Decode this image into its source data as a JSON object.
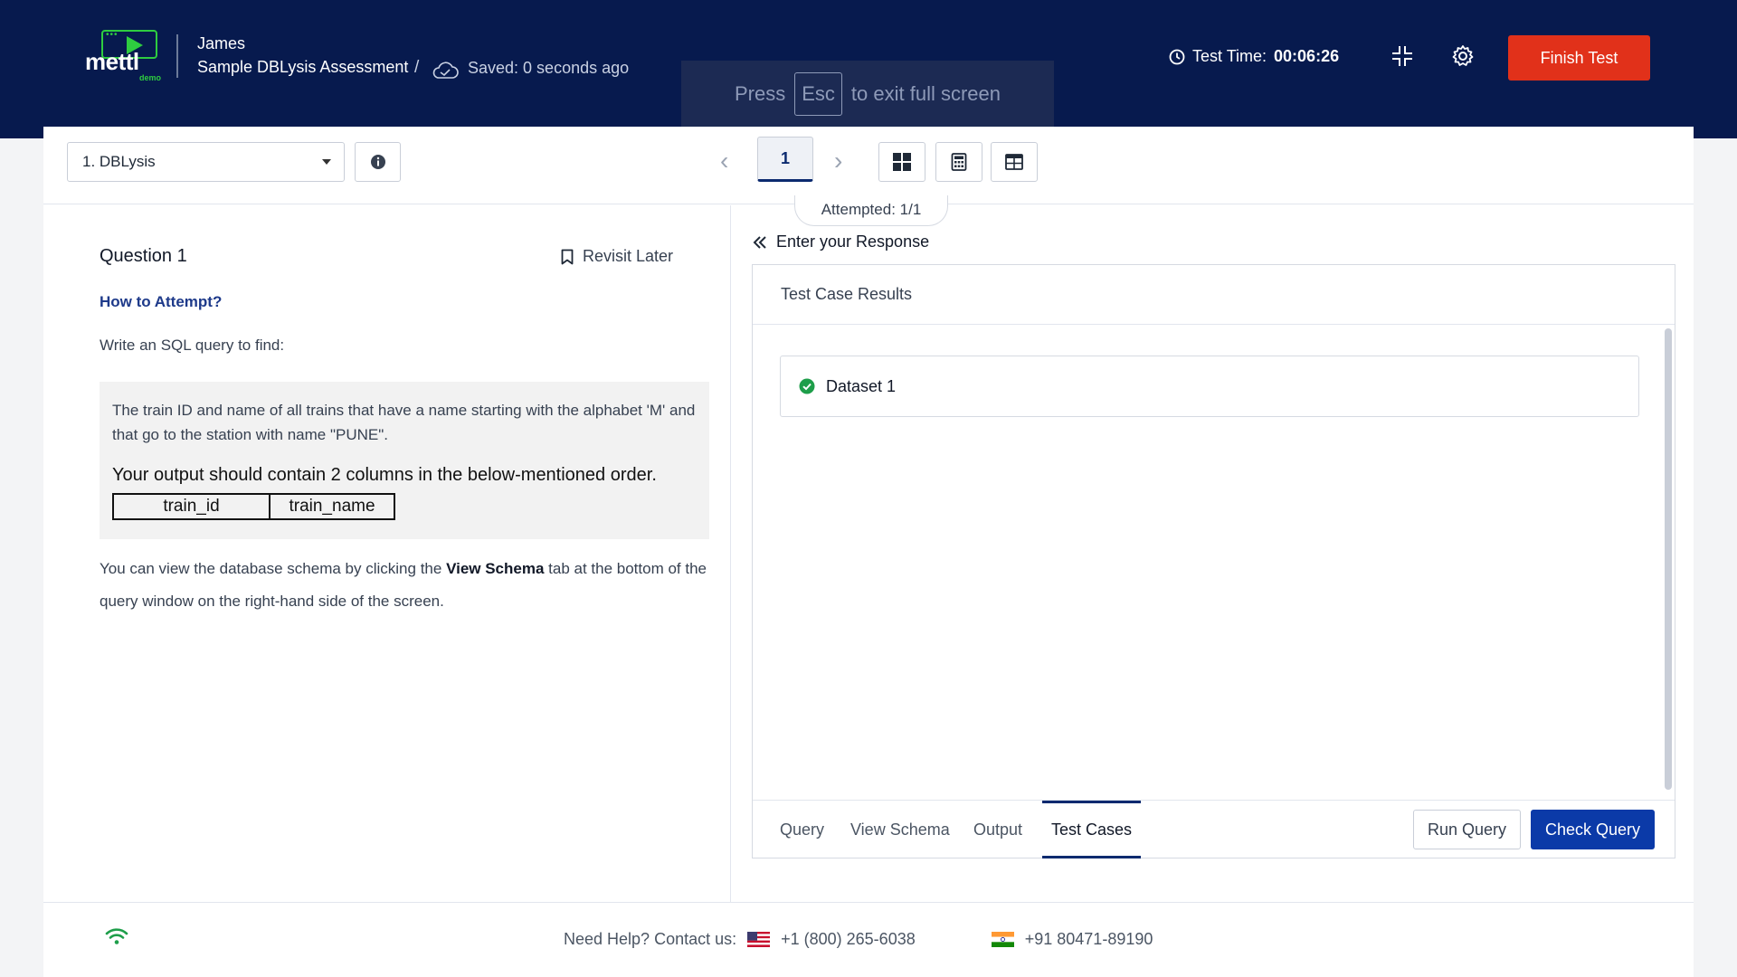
{
  "header": {
    "brand": "mettl",
    "brand_tag": "demo",
    "user_name": "James",
    "test_name": "Sample DBLysis Assessment",
    "separator": "/",
    "saved_status": "Saved: 0 seconds ago",
    "timer_label": "Test Time:",
    "timer_value": "00:06:26",
    "finish_label": "Finish Test"
  },
  "fullscreen_notice": {
    "press": "Press",
    "key": "Esc",
    "suffix": "to exit full screen"
  },
  "toolbar": {
    "section_select": "1. DBLysis",
    "prev_glyph": "‹",
    "next_glyph": "›",
    "current_question": "1",
    "attempted": "Attempted: 1/1"
  },
  "question": {
    "title": "Question 1",
    "revisit_label": "Revisit Later",
    "how_to_attempt": "How to Attempt?",
    "intro": "Write an SQL query to find:",
    "body": "The train ID and name of all trains that have a name starting with the alphabet 'M' and that go to the station with name \"PUNE\".",
    "output_instruction": "Your output should contain 2 columns in the below-mentioned order.",
    "columns": [
      "train_id",
      "train_name"
    ],
    "schema_note_before": "You can view the database schema by clicking the ",
    "schema_note_bold": "View Schema",
    "schema_note_after": " tab at the bottom of the query window on the right-hand side of the screen."
  },
  "response": {
    "heading": "Enter your Response",
    "results_title": "Test Case Results",
    "datasets": [
      {
        "label": "Dataset 1",
        "status": "passed"
      }
    ],
    "tabs": [
      {
        "label": "Query",
        "active": false
      },
      {
        "label": "View Schema",
        "active": false
      },
      {
        "label": "Output",
        "active": false
      },
      {
        "label": "Test Cases",
        "active": true
      }
    ],
    "run_label": "Run Query",
    "check_label": "Check Query"
  },
  "footer": {
    "help_label": "Need Help? Contact us:",
    "us_phone": "+1 (800) 265-6038",
    "in_phone": "+91 80471-89190"
  },
  "colors": {
    "header_bg": "#071a4e",
    "finish_bg": "#e1311a",
    "check_bg": "#0b3aa8",
    "success": "#1e9e4a"
  }
}
